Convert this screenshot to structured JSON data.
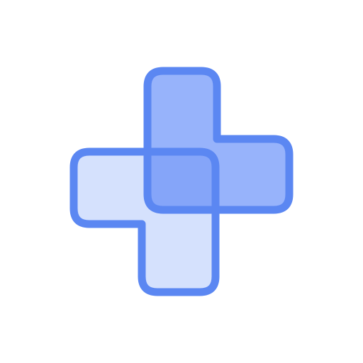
{
  "icon": {
    "name": "overlapping-puzzle-pieces-icon",
    "colors": {
      "outline": "#5b87f2",
      "back_piece_fill": "#97b3fb",
      "front_piece_fill": "#d5e1fd",
      "overlap_fill": "#85a5f9",
      "background": "#ffffff"
    }
  }
}
